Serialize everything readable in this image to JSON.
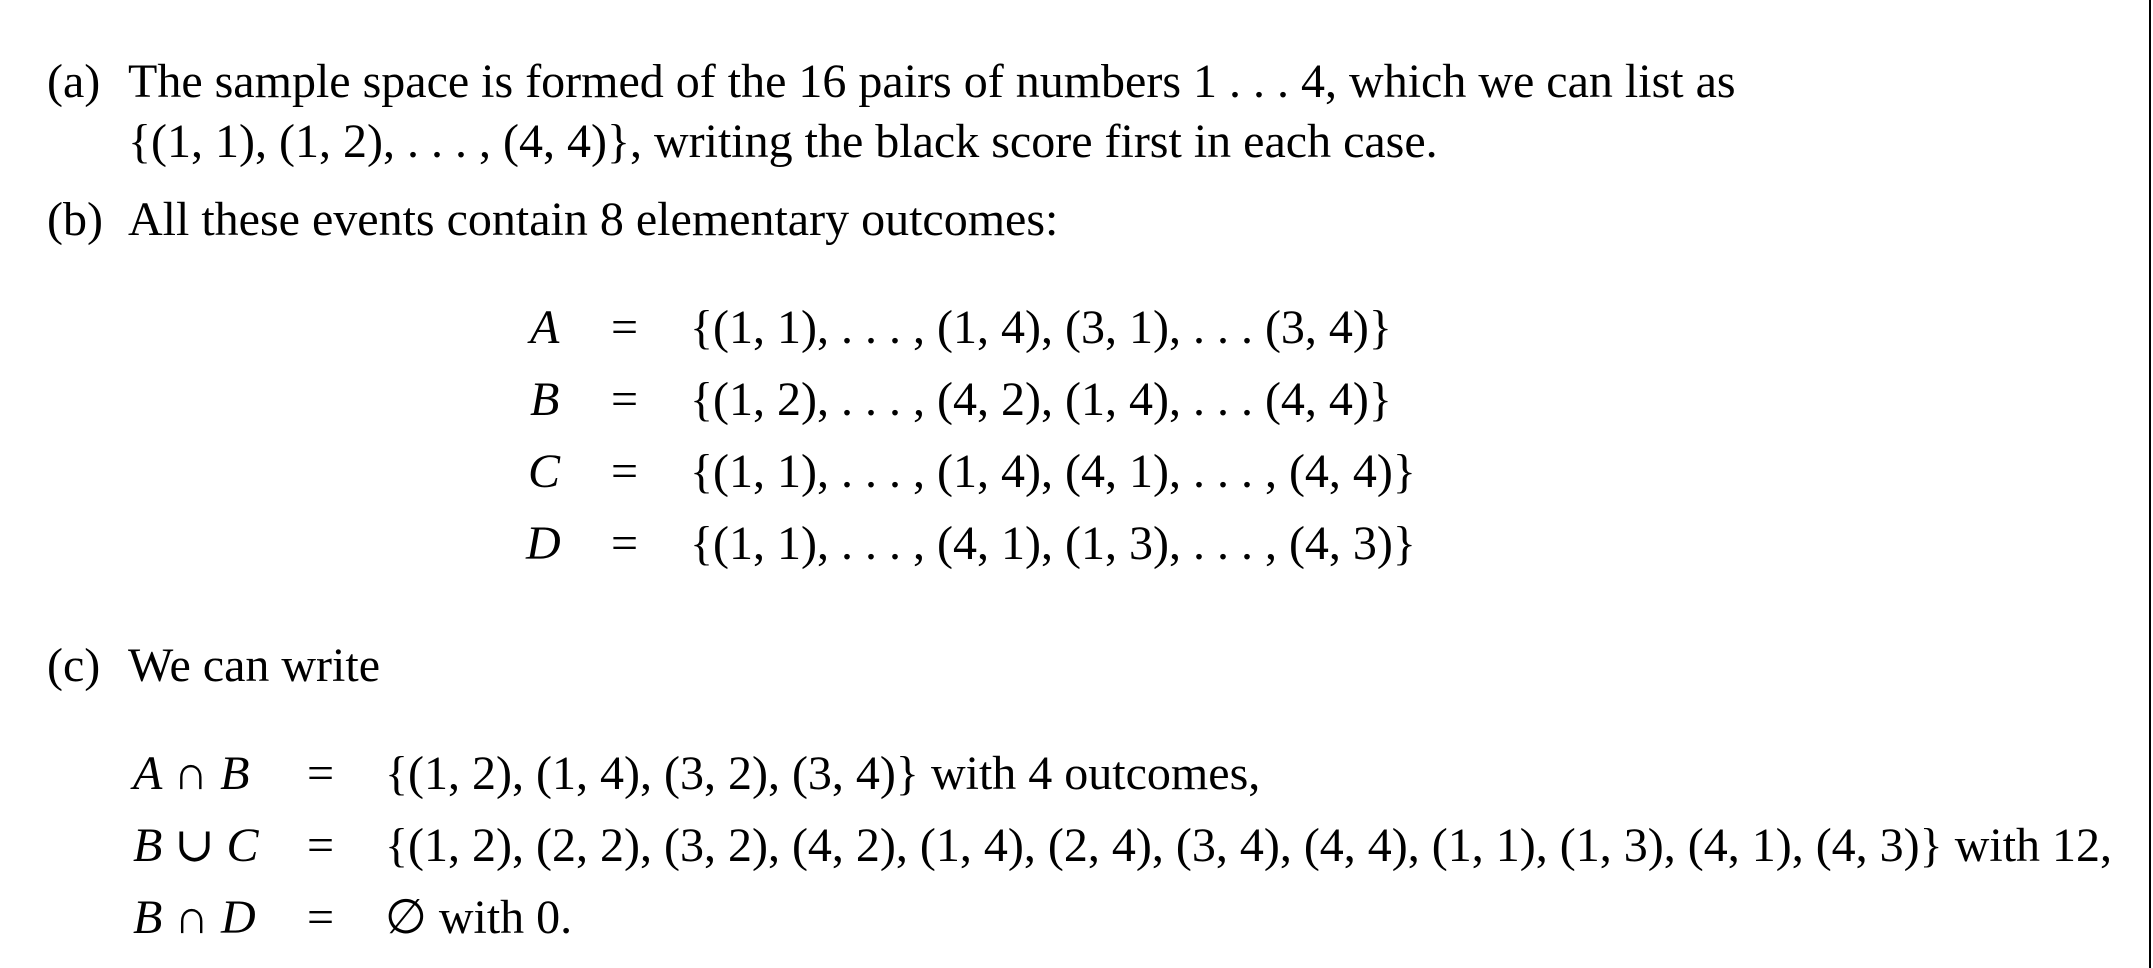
{
  "items": [
    {
      "label": "(a)",
      "lines": [
        "The sample space is formed of the 16 pairs of numbers 1 . . . 4, which we can list as",
        "{(1, 1), (1, 2), . . . , (4, 4)}, writing the black score first in each case."
      ]
    },
    {
      "label": "(b)",
      "intro": "All these events contain 8 elementary outcomes:",
      "equations": [
        {
          "lhs": "A",
          "eq": "=",
          "rhs": "{(1, 1), . . . , (1, 4), (3, 1), . . . (3, 4)}"
        },
        {
          "lhs": "B",
          "eq": "=",
          "rhs": "{(1, 2), . . . , (4, 2), (1, 4), . . . (4, 4)}"
        },
        {
          "lhs": "C",
          "eq": "=",
          "rhs": "{(1, 1), . . . , (1, 4), (4, 1), . . . , (4, 4)}"
        },
        {
          "lhs": "D",
          "eq": "=",
          "rhs": "{(1, 1), . . . , (4, 1), (1, 3), . . . , (4, 3)}"
        }
      ]
    },
    {
      "label": "(c)",
      "intro": "We can write",
      "equations": [
        {
          "lhs": "A ∩ B",
          "eq": "=",
          "rhs": "{(1, 2), (1, 4), (3, 2), (3, 4)} with 4 outcomes,"
        },
        {
          "lhs": "B ∪ C",
          "eq": "=",
          "rhs": "{(1, 2), (2, 2), (3, 2), (4, 2), (1, 4), (2, 4), (3, 4), (4, 4), (1, 1), (1, 3), (4, 1), (4, 3)} with 12,"
        },
        {
          "lhs": "B ∩ D",
          "eq": "=",
          "rhs": "∅ with 0."
        }
      ]
    }
  ]
}
